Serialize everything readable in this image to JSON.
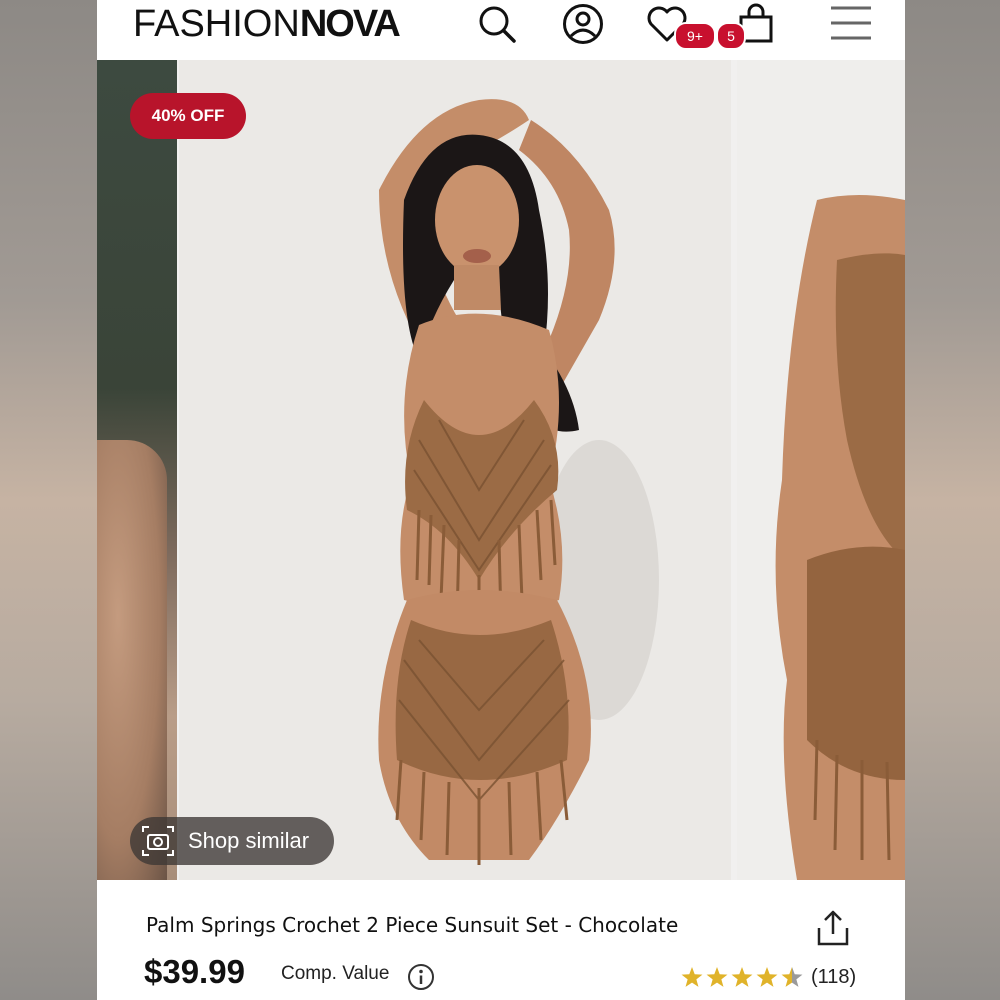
{
  "header": {
    "logo_light": "FASHION",
    "logo_bold": "NOVA",
    "wishlist_badge": "9+",
    "cart_badge": "5"
  },
  "gallery": {
    "discount_badge": "40% OFF",
    "shop_similar_label": "Shop similar"
  },
  "product": {
    "title": "Palm Springs Crochet 2 Piece Sunsuit Set - Chocolate",
    "price": "$39.99",
    "comp_value_label": "Comp. Value",
    "rating": 4.5,
    "review_count": "(118)"
  },
  "colors": {
    "accent_red": "#c8102e",
    "discount_red": "#b8142b",
    "star_gold": "#e0b32a",
    "text_dark": "#111111"
  },
  "icons": [
    "search-icon",
    "account-icon",
    "heart-icon",
    "shopping-bag-icon",
    "menu-icon",
    "camera-icon",
    "share-icon",
    "info-icon",
    "star-icon"
  ]
}
